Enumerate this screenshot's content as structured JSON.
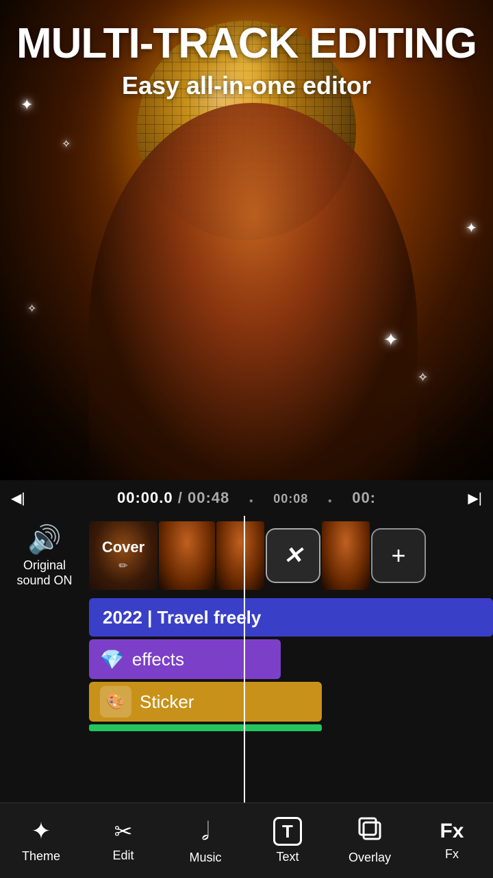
{
  "header": {
    "main_title": "MULTI-TRACK EDITING",
    "sub_title": "Easy all-in-one editor"
  },
  "timeline": {
    "time_current": "00:00",
    "time_current_fraction": ".0",
    "time_separator": " / ",
    "time_total": "00:48",
    "time_marker": "00:08",
    "time_end_partial": "00:"
  },
  "sound_control": {
    "label_line1": "Original",
    "label_line2": "sound ON"
  },
  "tracks": {
    "cover_label": "Cover",
    "text_track_label": "2022 | Travel freely",
    "effects_label": "effects",
    "sticker_label": "Sticker"
  },
  "nav": {
    "items": [
      {
        "id": "theme",
        "icon": "✦",
        "label": "Theme"
      },
      {
        "id": "edit",
        "icon": "✂",
        "label": "Edit"
      },
      {
        "id": "music",
        "icon": "♪",
        "label": "Music"
      },
      {
        "id": "text",
        "icon": "T",
        "label": "Text"
      },
      {
        "id": "overlay",
        "icon": "⊡",
        "label": "Overlay"
      },
      {
        "id": "fx",
        "icon": "F",
        "label": "Fx"
      }
    ]
  }
}
